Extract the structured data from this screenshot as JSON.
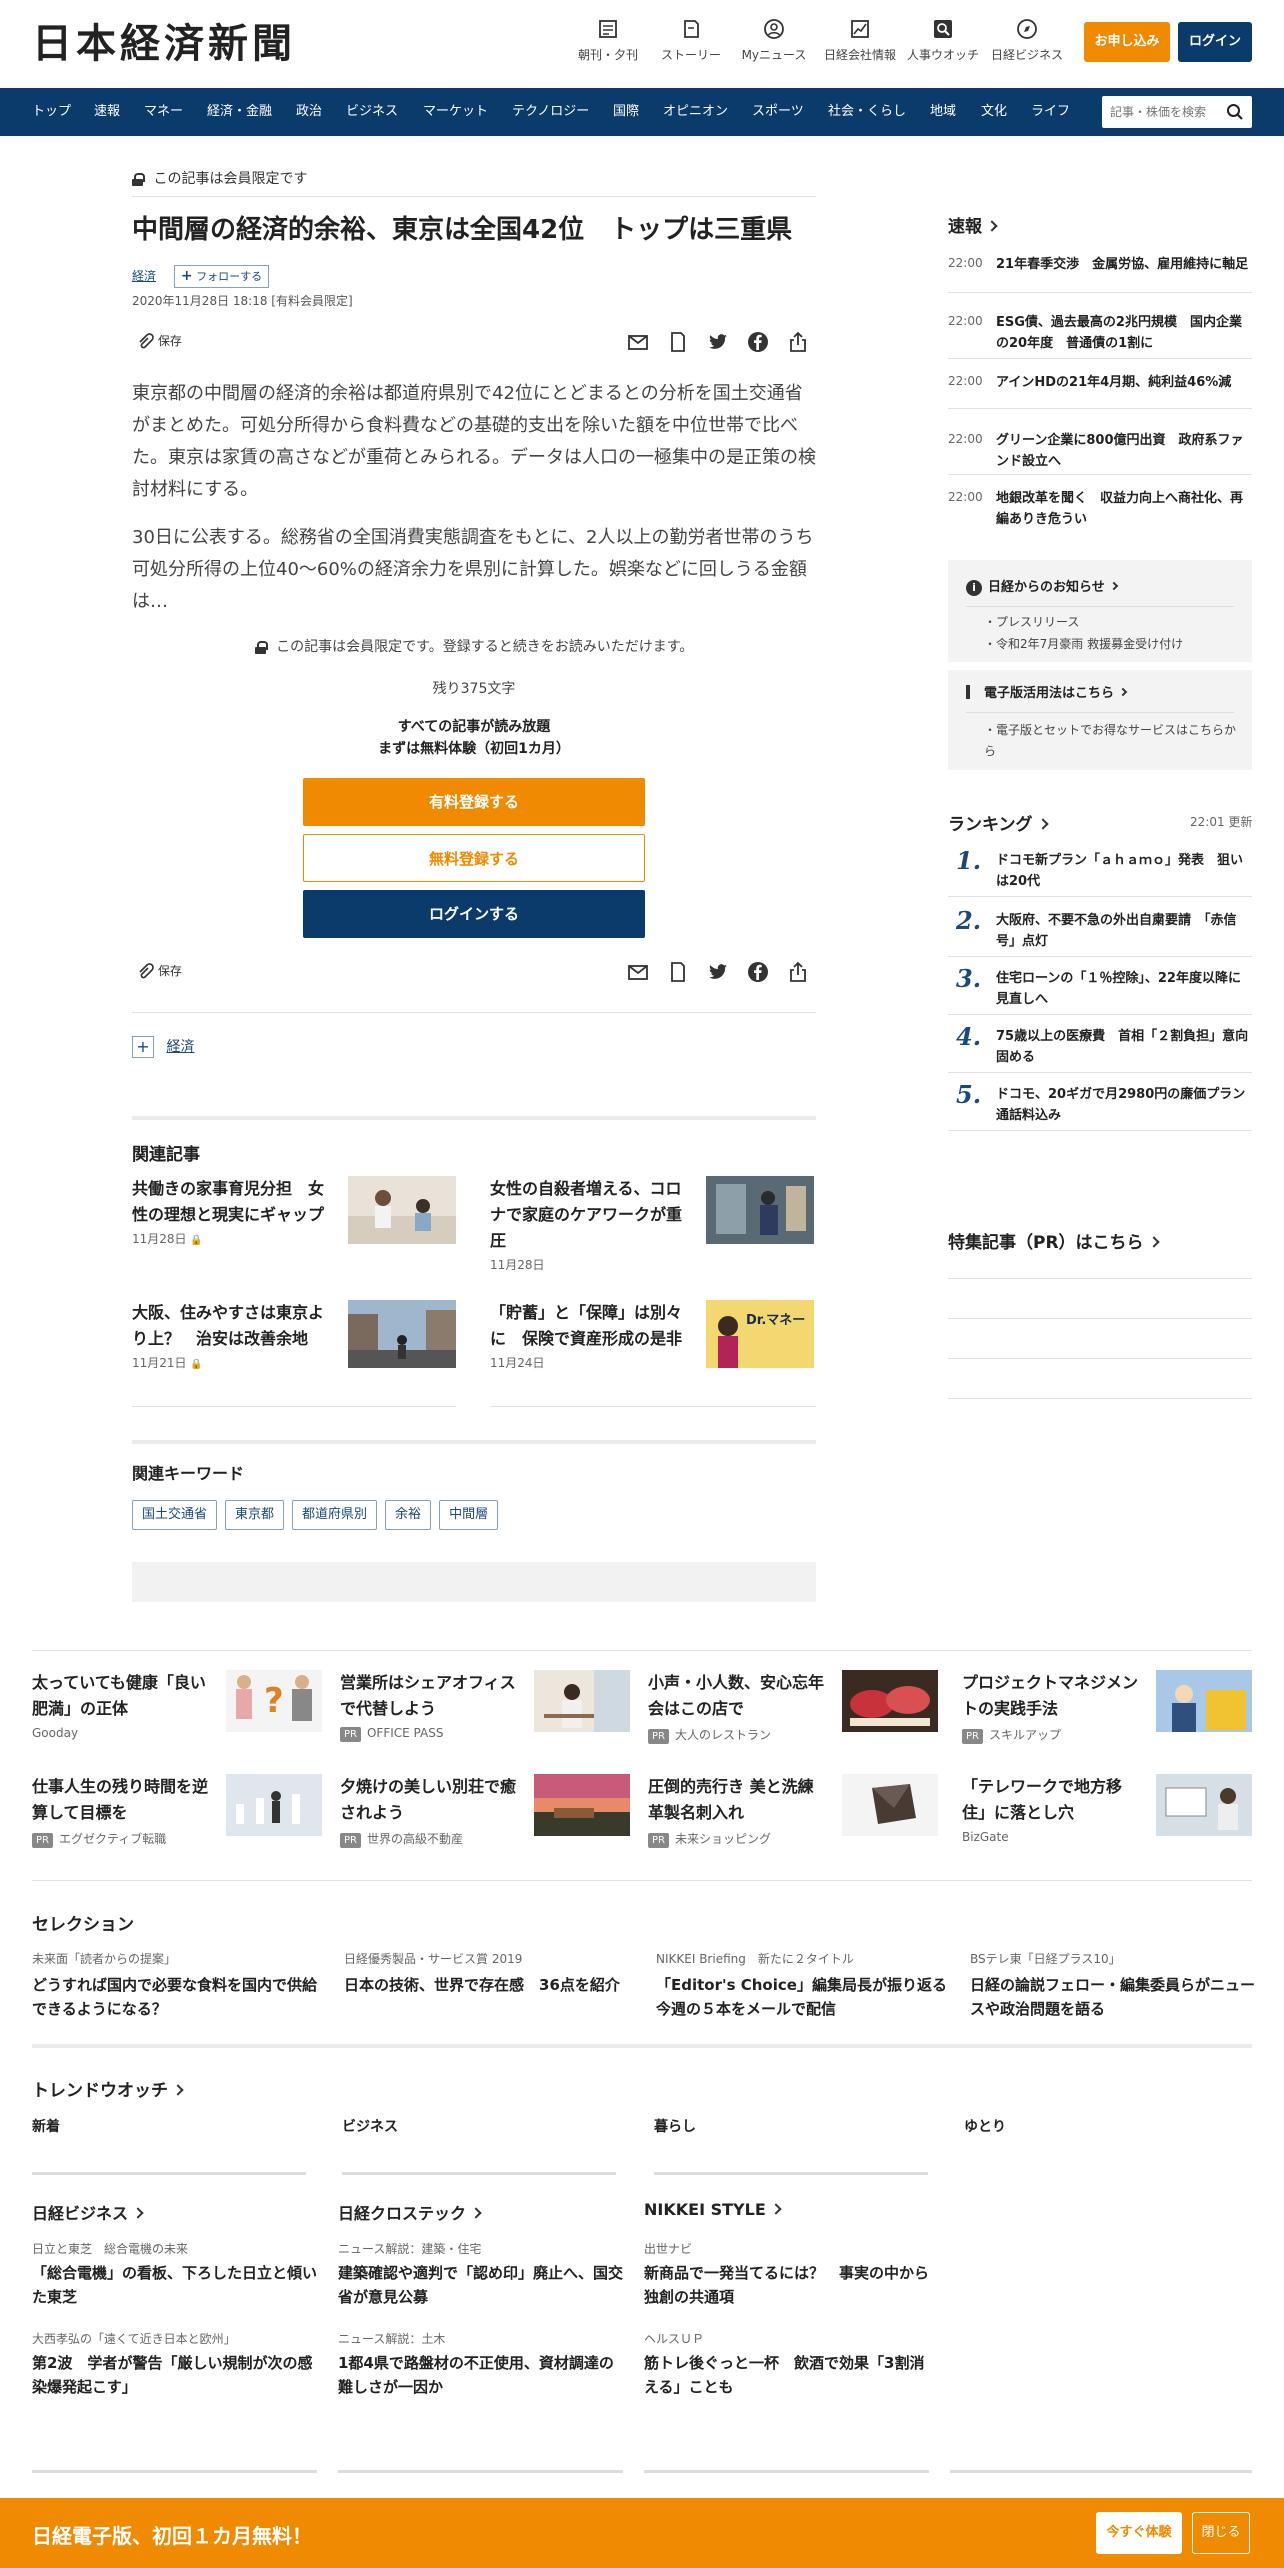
{
  "header": {
    "logo": "日本経済新聞",
    "nav_icons": [
      {
        "label": "朝刊・夕刊",
        "icon": "newspaper-icon"
      },
      {
        "label": "ストーリー",
        "icon": "book-icon"
      },
      {
        "label": "Myニュース",
        "icon": "user-icon"
      },
      {
        "label": "日経会社情報",
        "icon": "chart-icon"
      },
      {
        "label": "人事ウオッチ",
        "icon": "search-person-icon"
      },
      {
        "label": "日経ビジネス",
        "icon": "compass-icon"
      }
    ],
    "apply_label": "お申し込み",
    "login_label": "ログイン"
  },
  "navbar": {
    "items": [
      "トップ",
      "速報",
      "マネー",
      "経済・金融",
      "政治",
      "ビジネス",
      "マーケット",
      "テクノロジー",
      "国際",
      "オピニオン",
      "スポーツ",
      "社会・くらし",
      "地域",
      "文化",
      "ライフ"
    ],
    "search_placeholder": "記事・株価を検索"
  },
  "article": {
    "members_only": "この記事は会員限定です",
    "title": "中間層の経済的余裕、東京は全国42位　トップは三重県",
    "tag": "経済",
    "follow_label": "フォローする",
    "date": "2020年11月28日 18:18 [有料会員限定]",
    "save_label": "保存",
    "paragraphs": [
      "東京都の中間層の経済的余裕は都道府県別で42位にとどまるとの分析を国土交通省がまとめた。可処分所得から食料費などの基礎的支出を除いた額を中位世帯で比べた。東京は家賃の高さなどが重荷とみられる。データは人口の一極集中の是正策の検討材料にする。",
      "30日に公表する。総務省の全国消費実態調査をもとに、2人以上の勤労者世帯のうち可処分所得の上位40～60%の経済余力を県別に計算した。娯楽などに回しうる金額は…"
    ],
    "paywall_note": "この記事は会員限定です。登録すると続きをお読みいただけます。",
    "remaining": "残り375文字",
    "all_read": "すべての記事が読み放題",
    "trial": "まずは無料体験（初回1カ月）",
    "paid_register": "有料登録する",
    "free_register": "無料登録する",
    "login": "ログインする",
    "follow_topic": "経済"
  },
  "related": {
    "heading": "関連記事",
    "items": [
      {
        "title": "共働きの家事育児分担　女性の理想と現実にギャップ",
        "date": "11月28日"
      },
      {
        "title": "女性の自殺者増える、コロナで家庭のケアワークが重圧",
        "date": "11月28日"
      },
      {
        "title": "大阪、住みやすさは東京より上？　治安は改善余地",
        "date": "11月21日"
      },
      {
        "title": "「貯蓄」と「保障」は別々に　保険で資産形成の是非",
        "date": "11月24日",
        "img_text": "Dr.マネー"
      }
    ]
  },
  "keywords": {
    "heading": "関連キーワード",
    "items": [
      "国土交通省",
      "東京都",
      "都道府県別",
      "余裕",
      "中間層"
    ]
  },
  "sidebar": {
    "sokuho_heading": "速報",
    "sokuho": [
      {
        "time": "22:00",
        "text": "21年春季交渉　金属労協、雇用維持に軸足"
      },
      {
        "time": "22:00",
        "text": "ESG債、過去最高の2兆円規模　国内企業の20年度　普通債の1割に"
      },
      {
        "time": "22:00",
        "text": "アインHDの21年4月期、純利益46%減"
      },
      {
        "time": "22:00",
        "text": "グリーン企業に800億円出資　政府系ファンド設立へ"
      },
      {
        "time": "22:00",
        "text": "地銀改革を聞く　収益力向上へ商社化、再編ありき危うい"
      }
    ],
    "info_heading": "日経からのお知らせ",
    "info_items": [
      "プレスリリース",
      "令和2年7月豪雨 救援募金受け付け"
    ],
    "ebook_heading": "電子版活用法はこちら",
    "ebook_items": [
      "電子版とセットでお得なサービスはこちらから"
    ],
    "ranking_heading": "ランキング",
    "ranking_time": "22:01  更新",
    "ranking": [
      "ドコモ新プラン「ａｈａｍｏ」発表　狙いは20代",
      "大阪府、不要不急の外出自粛要請　「赤信号」点灯",
      "住宅ローンの「１％控除」、22年度以降に見直しへ",
      "75歳以上の医療費　首相「２割負担」意向固める",
      "ドコモ、20ギガで月2980円の廉価プラン　通話料込み"
    ],
    "pr_heading": "特集記事（PR）はこちら"
  },
  "ads": [
    {
      "title": "太っていても健康「良い肥満」の正体",
      "source": "Gooday",
      "pr": false
    },
    {
      "title": "営業所はシェアオフィスで代替しよう",
      "source": "OFFICE PASS",
      "pr": true
    },
    {
      "title": "小声・小人数、安心忘年会はこの店で",
      "source": "大人のレストラン",
      "pr": true
    },
    {
      "title": "プロジェクトマネジメントの実践手法",
      "source": "スキルアップ",
      "pr": true
    },
    {
      "title": "仕事人生の残り時間を逆算して目標を",
      "source": "エグゼクティブ転職",
      "pr": true
    },
    {
      "title": "夕焼けの美しい別荘で癒されよう",
      "source": "世界の高級不動産",
      "pr": true
    },
    {
      "title": "圧倒的売行き 美と洗練 革製名刺入れ",
      "source": "未来ショッピング",
      "pr": true
    },
    {
      "title": "「テレワークで地方移住」に落とし穴",
      "source": "BizGate",
      "pr": false
    }
  ],
  "pr_label": "PR",
  "selection": {
    "heading": "セレクション",
    "items": [
      {
        "label": "未来面「読者からの提案」",
        "text": "どうすれば国内で必要な食料を国内で供給できるようになる？"
      },
      {
        "label": "日経優秀製品・サービス賞 2019",
        "text": "日本の技術、世界で存在感　36点を紹介"
      },
      {
        "label": "NIKKEI Briefing　新たに２タイトル",
        "text": "「Editor's Choice」編集局長が振り返る今週の５本をメールで配信"
      },
      {
        "label": "BSテレ東「日経プラス10」",
        "text": "日経の論説フェロー・編集委員らがニュースや政治問題を語る"
      }
    ]
  },
  "trend": {
    "heading": "トレンドウオッチ",
    "tabs": [
      "新着",
      "ビジネス",
      "暮らし",
      "ゆとり"
    ]
  },
  "blocks": [
    {
      "heading": "日経ビジネス",
      "items": [
        {
          "label": "日立と東芝　総合電機の未来",
          "text": "「総合電機」の看板、下ろした日立と傾いた東芝"
        },
        {
          "label": "大西孝弘の「遠くて近き日本と欧州」",
          "text": "第2波　学者が警告「厳しい規制が次の感染爆発起こす」"
        }
      ]
    },
    {
      "heading": "日経クロステック",
      "items": [
        {
          "label": "ニュース解説：建築・住宅",
          "text": "建築確認や適判で「認め印」廃止へ、国交省が意見公募"
        },
        {
          "label": "ニュース解説：土木",
          "text": "1都4県で路盤材の不正使用、資材調達の難しさが一因か"
        }
      ]
    },
    {
      "heading": "NIKKEI STYLE",
      "items": [
        {
          "label": "出世ナビ",
          "text": "新商品で一発当てるには？　事実の中から独創の共通項"
        },
        {
          "label": "ヘルスＵＰ",
          "text": "筋トレ後ぐっと一杯　飲酒で効果「3割消える」ことも"
        }
      ]
    }
  ],
  "footer": {
    "message": "日経電子版、初回１カ月無料！",
    "try_label": "今すぐ体験",
    "close_label": "閉じる"
  },
  "colors": {
    "navy": "#0b3b6b",
    "orange": "#f08a00",
    "link_blue": "#1a4a7a"
  }
}
